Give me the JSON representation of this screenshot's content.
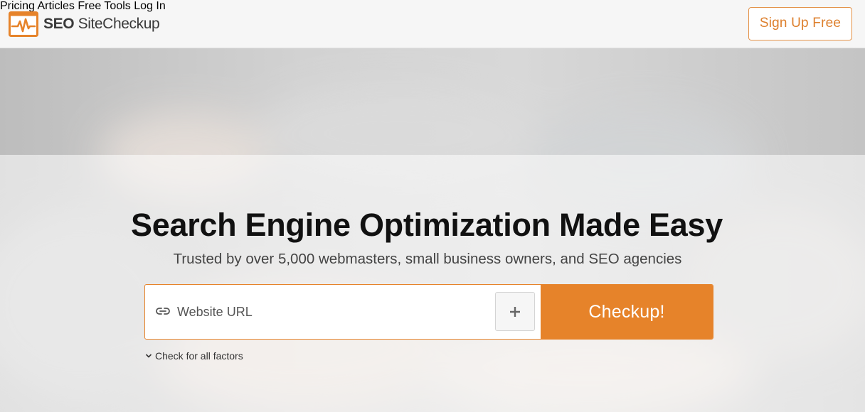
{
  "header": {
    "brand_bold": "SEO",
    "brand_rest": "SiteCheckup",
    "nav": [
      "Pricing",
      "Articles",
      "Free Tools",
      "Log In"
    ],
    "signup_label": "Sign Up Free"
  },
  "hero": {
    "title": "Search Engine Optimization Made Easy",
    "subtitle": "Trusted by over 5,000 webmasters, small business owners, and SEO agencies",
    "url_placeholder": "Website URL",
    "checkup_label": "Checkup!",
    "factors_label": "Check for all factors"
  },
  "colors": {
    "accent": "#e6832a",
    "signup_text": "#dd7f2c"
  },
  "icons": {
    "logo": "pulse-monitor-icon",
    "url": "link-icon",
    "add": "plus-icon",
    "expand": "chevron-down-icon"
  }
}
